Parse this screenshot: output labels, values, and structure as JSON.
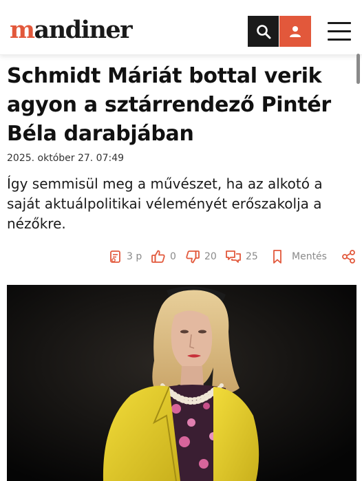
{
  "header": {
    "logo_prefix": "m",
    "logo_rest": "andiner",
    "brand_color": "#e2583b",
    "search_icon": "search-icon",
    "user_icon": "user-icon",
    "menu_icon": "hamburger-menu-icon"
  },
  "article": {
    "title": "Schmidt Máriát bottal verik agyon a sztárrendező Pintér Béla darabjában",
    "date": "2025. október 27. 07:49",
    "lead": "Így semmisül meg a művészet, ha az alkotó a saját aktuálpolitikai véleményét erőszakolja a nézőkre."
  },
  "stats": {
    "read_time": "3 p",
    "likes": "0",
    "dislikes": "20",
    "comments": "25",
    "save_label": "Mentés"
  }
}
